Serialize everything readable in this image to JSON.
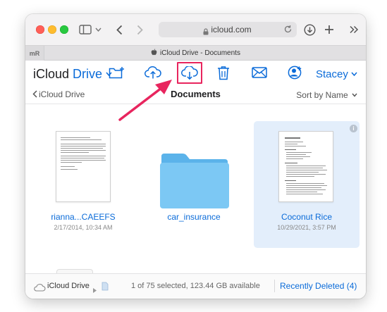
{
  "browser": {
    "url": "icloud.com",
    "tab_favicon": "mR",
    "tab_title": "iCloud Drive - Documents"
  },
  "app": {
    "brand_icloud": "iCloud",
    "brand_drive": "Drive",
    "user_name": "Stacey",
    "accent_color": "#0a6bd9",
    "highlight_color": "#e8255e"
  },
  "nav": {
    "back_label": "iCloud Drive",
    "current_folder": "Documents",
    "sort_label": "Sort by Name"
  },
  "files": [
    {
      "name": "rianna...CAEEFS",
      "date": "2/17/2014, 10:34 AM",
      "kind": "document"
    },
    {
      "name": "car_insurance",
      "date": "",
      "kind": "folder"
    },
    {
      "name": "Coconut Rice",
      "date": "10/29/2021, 3:57 PM",
      "kind": "document",
      "selected": true
    }
  ],
  "status": {
    "location": "iCloud Drive",
    "selection_info": "1 of 75 selected, 123.44 GB available",
    "recently_deleted": "Recently Deleted (4)"
  }
}
